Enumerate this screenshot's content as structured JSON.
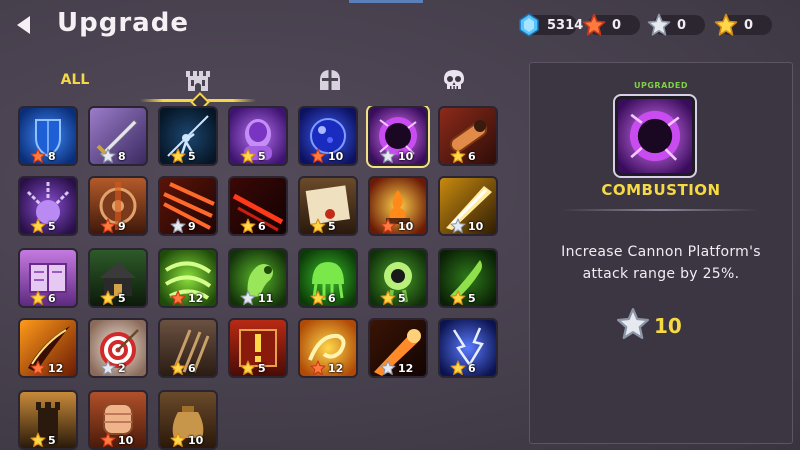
{
  "header": {
    "title": "Upgrade"
  },
  "currencies": [
    {
      "name": "gem",
      "value": "5314",
      "color": "#5ec9ff"
    },
    {
      "name": "red-star",
      "value": "0",
      "color": "#ff6a3a"
    },
    {
      "name": "silver-star",
      "value": "0",
      "color": "#c6ccd6"
    },
    {
      "name": "gold-star",
      "value": "0",
      "color": "#ffc83a"
    }
  ],
  "tabs": {
    "all_label": "ALL",
    "items": [
      "tower-icon",
      "helmet-icon",
      "skull-icon"
    ],
    "active": 1
  },
  "grid": {
    "selected": 5,
    "items": [
      {
        "icon": "shield",
        "star": "red",
        "count": "8"
      },
      {
        "icon": "sword",
        "star": "silver",
        "count": "8"
      },
      {
        "icon": "spear-thrower",
        "star": "gold",
        "count": "5"
      },
      {
        "icon": "purple-golem",
        "star": "gold",
        "count": "5"
      },
      {
        "icon": "blue-orb",
        "star": "red",
        "count": "10"
      },
      {
        "icon": "combustion-orb",
        "star": "silver",
        "count": "10"
      },
      {
        "icon": "cannon",
        "star": "gold",
        "count": "6"
      },
      {
        "icon": "chained-orb",
        "star": "gold",
        "count": "5"
      },
      {
        "icon": "round-shield",
        "star": "red",
        "count": "9"
      },
      {
        "icon": "red-slash",
        "star": "silver",
        "count": "9"
      },
      {
        "icon": "red-streak",
        "star": "gold",
        "count": "6"
      },
      {
        "icon": "scroll",
        "star": "gold",
        "count": "5"
      },
      {
        "icon": "fire-burst",
        "star": "red",
        "count": "10"
      },
      {
        "icon": "light-beam",
        "star": "silver",
        "count": "10"
      },
      {
        "icon": "magic-book",
        "star": "gold",
        "count": "6"
      },
      {
        "icon": "hut",
        "star": "gold",
        "count": "5"
      },
      {
        "icon": "green-wind",
        "star": "red",
        "count": "12"
      },
      {
        "icon": "green-hand",
        "star": "silver",
        "count": "11"
      },
      {
        "icon": "green-jelly",
        "star": "gold",
        "count": "6"
      },
      {
        "icon": "green-eye",
        "star": "gold",
        "count": "5"
      },
      {
        "icon": "green-claw",
        "star": "gold",
        "count": "5"
      },
      {
        "icon": "fire-slash",
        "star": "red",
        "count": "12"
      },
      {
        "icon": "target",
        "star": "silver",
        "count": "2"
      },
      {
        "icon": "arrows",
        "star": "gold",
        "count": "6"
      },
      {
        "icon": "alert-book",
        "star": "gold",
        "count": "5"
      },
      {
        "icon": "fire-swirl",
        "star": "red",
        "count": "12"
      },
      {
        "icon": "orange-beam",
        "star": "silver",
        "count": "12"
      },
      {
        "icon": "blue-lightning",
        "star": "gold",
        "count": "6"
      },
      {
        "icon": "dark-tower",
        "star": "gold",
        "count": "5"
      },
      {
        "icon": "fist",
        "star": "red",
        "count": "10"
      },
      {
        "icon": "money-bag",
        "star": "gold",
        "count": "10"
      }
    ]
  },
  "detail": {
    "status": "UPGRADED",
    "name": "COMBUSTION",
    "description": "Increase Cannon Platform's attack range by 25%.",
    "cost_star": "silver",
    "cost": "10"
  }
}
